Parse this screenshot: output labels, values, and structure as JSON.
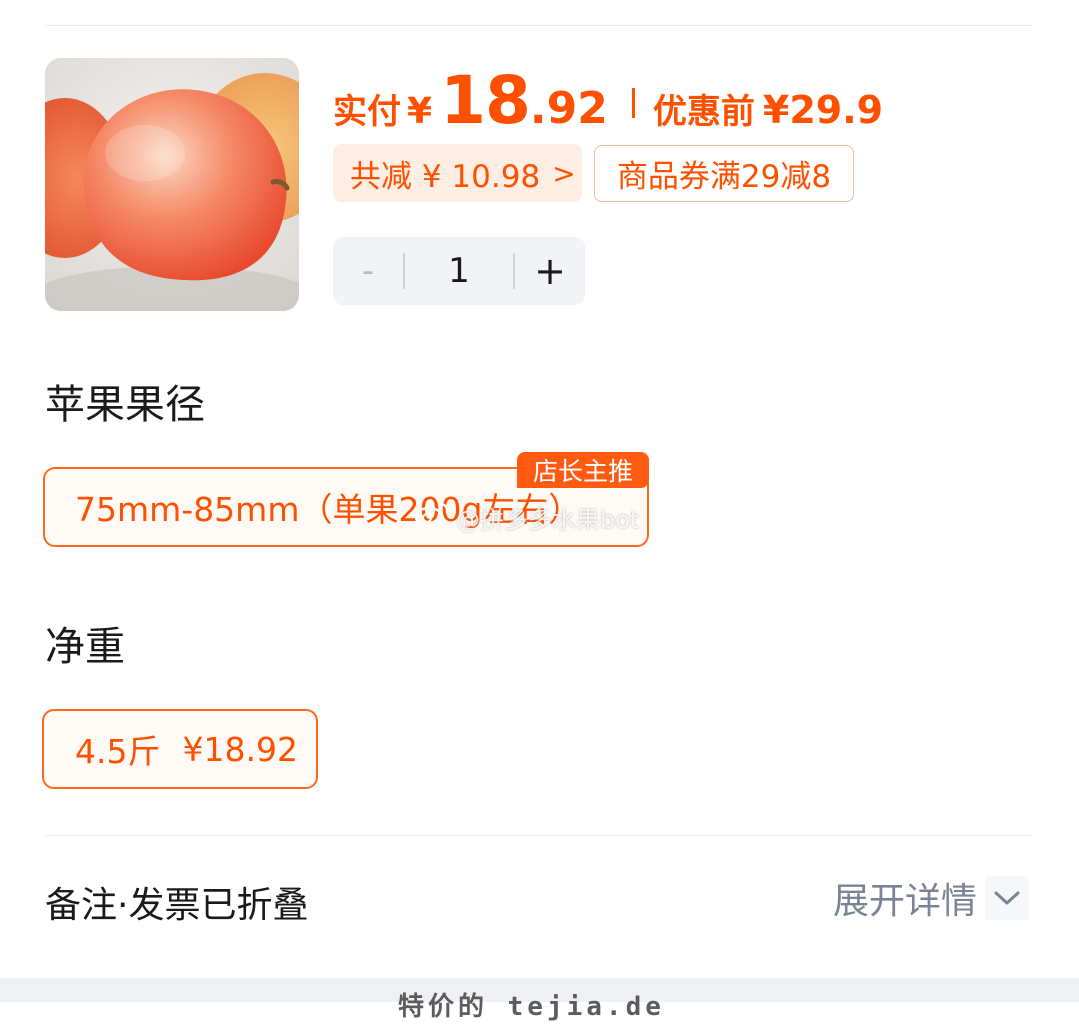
{
  "product": {
    "image_alt": "apple-photo",
    "price_label": "实付",
    "price_yen": "¥",
    "price_int": "18",
    "price_dot": ".",
    "price_dec": "92",
    "orig_label": "优惠前",
    "orig_price": "¥29.9",
    "total_discount": "共减 ¥ 10.98",
    "total_discount_chevron": ">",
    "coupon": "商品券满29减8",
    "quantity": "1",
    "minus": "-",
    "plus": "+"
  },
  "spec_size": {
    "title": "苹果果径",
    "option": "75mm-85mm（单果200g左右）",
    "badge": "店长主推"
  },
  "spec_weight": {
    "title": "净重",
    "option_weight": "4.5斤",
    "option_price": "¥18.92"
  },
  "watermark": "@拼多多水果bot",
  "footer": {
    "remark": "备注·发票已折叠",
    "expand": "展开详情"
  },
  "site_watermark": "特价的 tejia.de",
  "colors": {
    "accent": "#ff5000",
    "chip_bg": "#ffeee4",
    "stepper_bg": "#f1f3f6",
    "muted": "#7a8494"
  }
}
